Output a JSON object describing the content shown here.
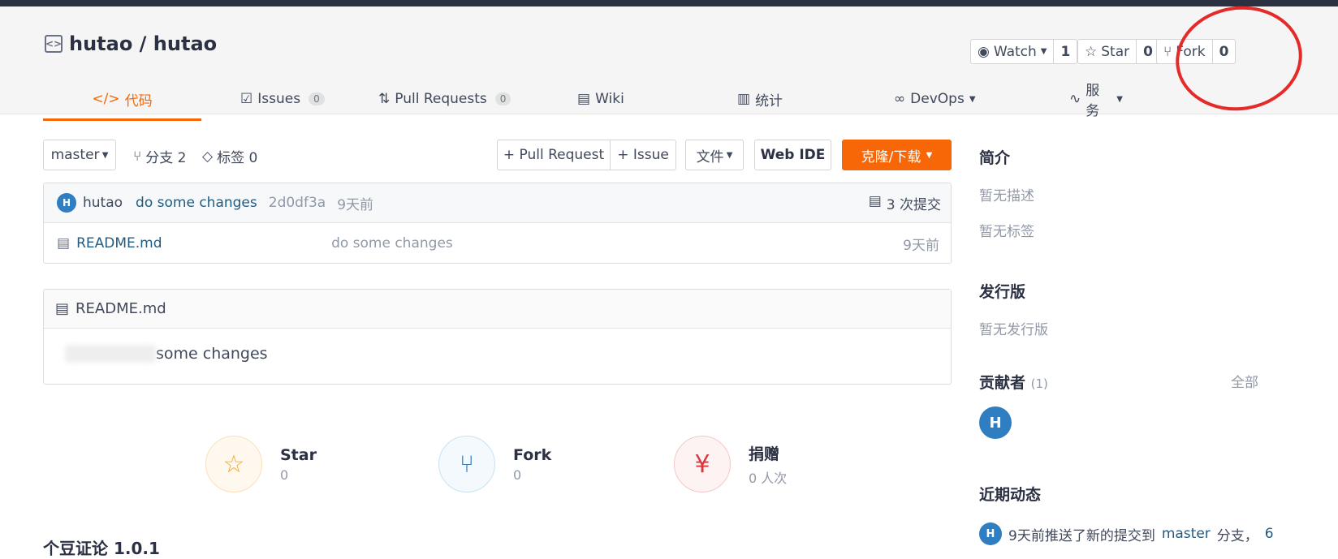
{
  "repo": {
    "title": "hutao / hutao"
  },
  "actions": {
    "watch": {
      "label": "Watch",
      "count": "1"
    },
    "star": {
      "label": "Star",
      "count": "0"
    },
    "fork": {
      "label": "Fork",
      "count": "0"
    }
  },
  "tabs": [
    {
      "label": "代码",
      "icon": "code-icon"
    },
    {
      "label": "Issues",
      "badge": "0",
      "icon": "issues-icon"
    },
    {
      "label": "Pull Requests",
      "badge": "0",
      "icon": "pull-request-icon"
    },
    {
      "label": "Wiki",
      "icon": "wiki-icon"
    },
    {
      "label": "统计",
      "icon": "stats-icon"
    },
    {
      "label": "DevOps",
      "icon": "devops-icon"
    },
    {
      "label": "服务",
      "icon": "service-icon"
    }
  ],
  "toolbar": {
    "branch": "master",
    "branches": "分支 2",
    "tags": "标签 0",
    "pull_request": "+ Pull Request",
    "issue": "+ Issue",
    "files": "文件",
    "web_ide": "Web IDE",
    "clone": "克隆/下载"
  },
  "commit": {
    "author": "hutao",
    "avatar": "H",
    "message": "do some changes",
    "hash": "2d0df3a",
    "time": "9天前",
    "count": "3 次提交"
  },
  "files": [
    {
      "name": "README.md",
      "message": "do some changes",
      "time": "9天前"
    }
  ],
  "readme": {
    "title": "README.md",
    "content": "some changes"
  },
  "stats": [
    {
      "title": "Star",
      "value": "0"
    },
    {
      "title": "Fork",
      "value": "0"
    },
    {
      "title": "捐赠",
      "value": "0 人次"
    }
  ],
  "bottom_partial": "个豆证论 1.0.1",
  "sidebar": {
    "intro_title": "简介",
    "no_desc": "暂无描述",
    "no_tags": "暂无标签",
    "release_title": "发行版",
    "no_release": "暂无发行版",
    "contributors_title": "贡献者",
    "contributors_count": "(1)",
    "all": "全部",
    "contributor_avatar": "H",
    "activity_title": "近期动态",
    "activity_avatar": "H",
    "activity_text": "9天前推送了新的提交到",
    "activity_branch": "master",
    "activity_suffix": "分支，",
    "activity_count": "6"
  },
  "colors": {
    "accent": "#f76707",
    "link": "#225b7f",
    "annotation": "#e52a2a",
    "avatar": "#2f7ec1"
  }
}
